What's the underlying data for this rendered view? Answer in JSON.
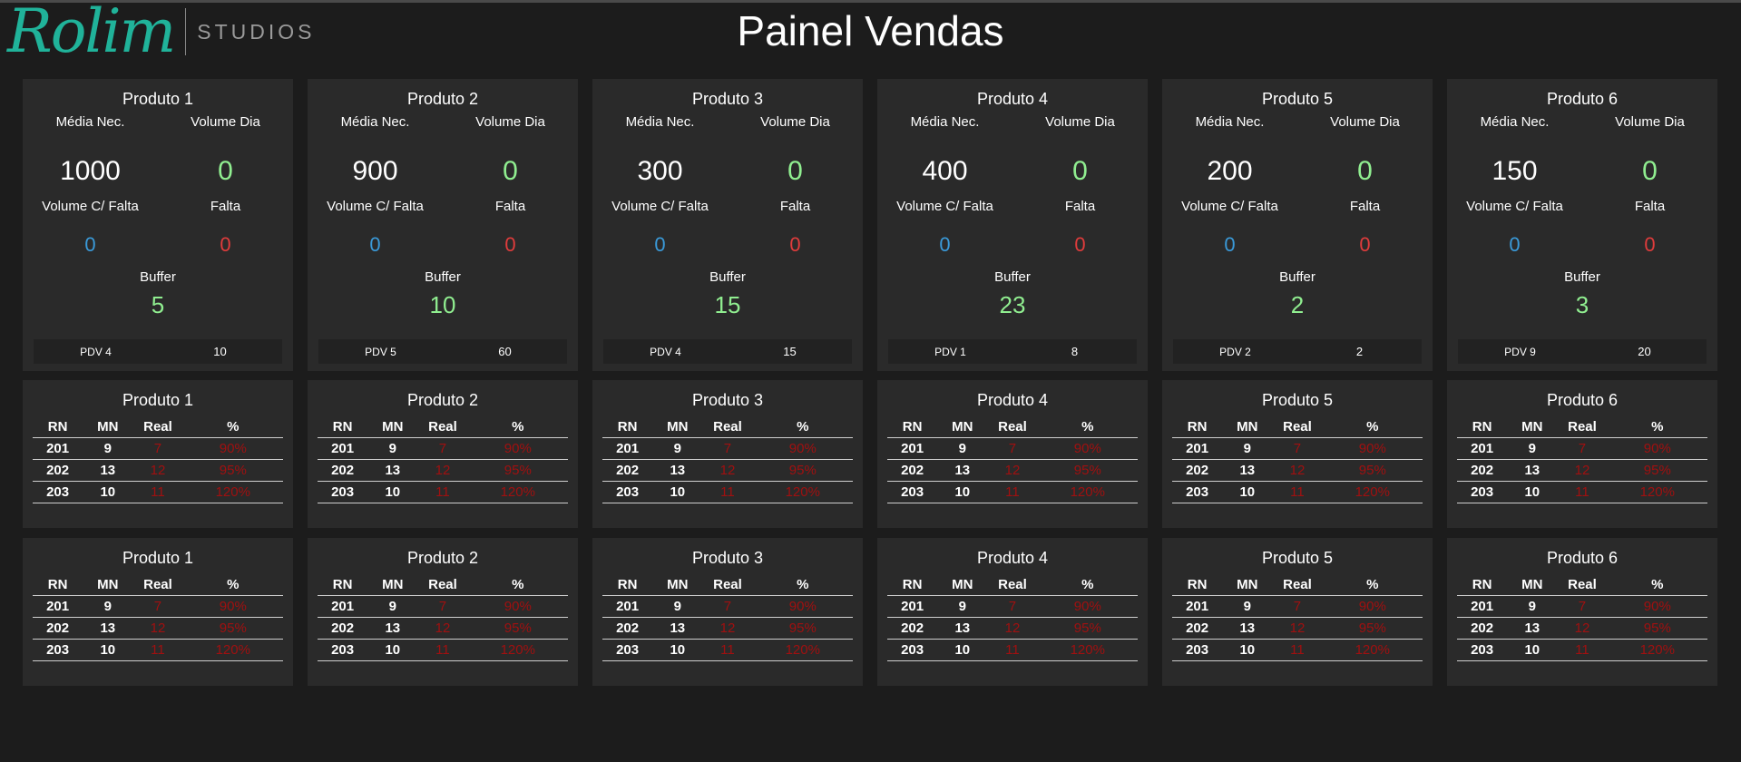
{
  "header": {
    "logo_script": "Rolim",
    "logo_sub": "STUDIOS",
    "title": "Painel Vendas"
  },
  "colors": {
    "background": "#1c1c1c",
    "card": "#2a2a2a",
    "logo_teal": "#20b39a",
    "value_green": "#90ee90",
    "value_blue": "#3a9ad9",
    "value_red": "#e03c3c",
    "table_red": "#a01010"
  },
  "labels": {
    "media_nec": "Média Nec.",
    "volume_dia": "Volume Dia",
    "volume_c_falta": "Volume C/ Falta",
    "falta": "Falta",
    "buffer": "Buffer",
    "col_rn": "RN",
    "col_mn": "MN",
    "col_real": "Real",
    "col_pct": "%"
  },
  "summary": [
    {
      "name": "Produto 1",
      "media_nec": "1000",
      "volume_dia": "0",
      "volume_c_falta": "0",
      "falta": "0",
      "buffer": "5",
      "pdv": "PDV 4",
      "pdv_value": "10"
    },
    {
      "name": "Produto 2",
      "media_nec": "900",
      "volume_dia": "0",
      "volume_c_falta": "0",
      "falta": "0",
      "buffer": "10",
      "pdv": "PDV 5",
      "pdv_value": "60"
    },
    {
      "name": "Produto 3",
      "media_nec": "300",
      "volume_dia": "0",
      "volume_c_falta": "0",
      "falta": "0",
      "buffer": "15",
      "pdv": "PDV 4",
      "pdv_value": "15"
    },
    {
      "name": "Produto 4",
      "media_nec": "400",
      "volume_dia": "0",
      "volume_c_falta": "0",
      "falta": "0",
      "buffer": "23",
      "pdv": "PDV 1",
      "pdv_value": "8"
    },
    {
      "name": "Produto 5",
      "media_nec": "200",
      "volume_dia": "0",
      "volume_c_falta": "0",
      "falta": "0",
      "buffer": "2",
      "pdv": "PDV 2",
      "pdv_value": "2"
    },
    {
      "name": "Produto 6",
      "media_nec": "150",
      "volume_dia": "0",
      "volume_c_falta": "0",
      "falta": "0",
      "buffer": "3",
      "pdv": "PDV 9",
      "pdv_value": "20"
    }
  ],
  "tables_row1": [
    {
      "name": "Produto 1",
      "rows": [
        {
          "rn": "201",
          "mn": "9",
          "real": "7",
          "pct": "90%"
        },
        {
          "rn": "202",
          "mn": "13",
          "real": "12",
          "pct": "95%"
        },
        {
          "rn": "203",
          "mn": "10",
          "real": "11",
          "pct": "120%"
        }
      ]
    },
    {
      "name": "Produto 2",
      "rows": [
        {
          "rn": "201",
          "mn": "9",
          "real": "7",
          "pct": "90%"
        },
        {
          "rn": "202",
          "mn": "13",
          "real": "12",
          "pct": "95%"
        },
        {
          "rn": "203",
          "mn": "10",
          "real": "11",
          "pct": "120%"
        }
      ]
    },
    {
      "name": "Produto 3",
      "rows": [
        {
          "rn": "201",
          "mn": "9",
          "real": "7",
          "pct": "90%"
        },
        {
          "rn": "202",
          "mn": "13",
          "real": "12",
          "pct": "95%"
        },
        {
          "rn": "203",
          "mn": "10",
          "real": "11",
          "pct": "120%"
        }
      ]
    },
    {
      "name": "Produto 4",
      "rows": [
        {
          "rn": "201",
          "mn": "9",
          "real": "7",
          "pct": "90%"
        },
        {
          "rn": "202",
          "mn": "13",
          "real": "12",
          "pct": "95%"
        },
        {
          "rn": "203",
          "mn": "10",
          "real": "11",
          "pct": "120%"
        }
      ]
    },
    {
      "name": "Produto 5",
      "rows": [
        {
          "rn": "201",
          "mn": "9",
          "real": "7",
          "pct": "90%"
        },
        {
          "rn": "202",
          "mn": "13",
          "real": "12",
          "pct": "95%"
        },
        {
          "rn": "203",
          "mn": "10",
          "real": "11",
          "pct": "120%"
        }
      ]
    },
    {
      "name": "Produto 6",
      "rows": [
        {
          "rn": "201",
          "mn": "9",
          "real": "7",
          "pct": "90%"
        },
        {
          "rn": "202",
          "mn": "13",
          "real": "12",
          "pct": "95%"
        },
        {
          "rn": "203",
          "mn": "10",
          "real": "11",
          "pct": "120%"
        }
      ]
    }
  ],
  "tables_row2": [
    {
      "name": "Produto 1",
      "rows": [
        {
          "rn": "201",
          "mn": "9",
          "real": "7",
          "pct": "90%"
        },
        {
          "rn": "202",
          "mn": "13",
          "real": "12",
          "pct": "95%"
        },
        {
          "rn": "203",
          "mn": "10",
          "real": "11",
          "pct": "120%"
        }
      ]
    },
    {
      "name": "Produto 2",
      "rows": [
        {
          "rn": "201",
          "mn": "9",
          "real": "7",
          "pct": "90%"
        },
        {
          "rn": "202",
          "mn": "13",
          "real": "12",
          "pct": "95%"
        },
        {
          "rn": "203",
          "mn": "10",
          "real": "11",
          "pct": "120%"
        }
      ]
    },
    {
      "name": "Produto 3",
      "rows": [
        {
          "rn": "201",
          "mn": "9",
          "real": "7",
          "pct": "90%"
        },
        {
          "rn": "202",
          "mn": "13",
          "real": "12",
          "pct": "95%"
        },
        {
          "rn": "203",
          "mn": "10",
          "real": "11",
          "pct": "120%"
        }
      ]
    },
    {
      "name": "Produto 4",
      "rows": [
        {
          "rn": "201",
          "mn": "9",
          "real": "7",
          "pct": "90%"
        },
        {
          "rn": "202",
          "mn": "13",
          "real": "12",
          "pct": "95%"
        },
        {
          "rn": "203",
          "mn": "10",
          "real": "11",
          "pct": "120%"
        }
      ]
    },
    {
      "name": "Produto 5",
      "rows": [
        {
          "rn": "201",
          "mn": "9",
          "real": "7",
          "pct": "90%"
        },
        {
          "rn": "202",
          "mn": "13",
          "real": "12",
          "pct": "95%"
        },
        {
          "rn": "203",
          "mn": "10",
          "real": "11",
          "pct": "120%"
        }
      ]
    },
    {
      "name": "Produto 6",
      "rows": [
        {
          "rn": "201",
          "mn": "9",
          "real": "7",
          "pct": "90%"
        },
        {
          "rn": "202",
          "mn": "13",
          "real": "12",
          "pct": "95%"
        },
        {
          "rn": "203",
          "mn": "10",
          "real": "11",
          "pct": "120%"
        }
      ]
    }
  ]
}
